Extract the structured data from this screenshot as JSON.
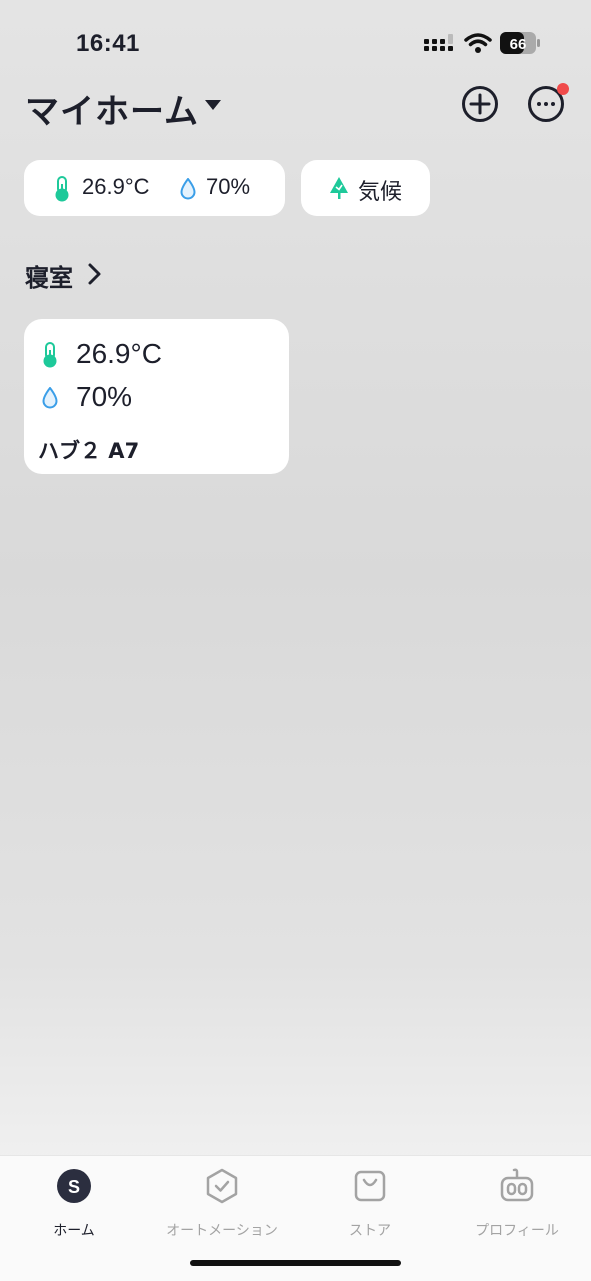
{
  "status": {
    "time": "16:41",
    "battery": "66"
  },
  "header": {
    "title": "マイホーム"
  },
  "summary": {
    "temperature": "26.9°C",
    "humidity": "70%",
    "weather_label": "気候"
  },
  "room": {
    "name": "寝室",
    "devices": [
      {
        "temperature": "26.9°C",
        "humidity": "70%",
        "name": "ハブ２ A7"
      }
    ]
  },
  "tabs": [
    {
      "label": "ホーム",
      "icon": "home-s-icon",
      "active": true
    },
    {
      "label": "オートメーション",
      "icon": "automation-icon",
      "active": false
    },
    {
      "label": "ストア",
      "icon": "store-bag-icon",
      "active": false
    },
    {
      "label": "プロフィール",
      "icon": "profile-robot-icon",
      "active": false
    }
  ],
  "colors": {
    "accent_green": "#1ec99a",
    "drop_blue": "#3a9ee8",
    "notification_red": "#f04a4a",
    "text_dark": "#1d1f2b",
    "tab_inactive": "#a3a3a3"
  }
}
